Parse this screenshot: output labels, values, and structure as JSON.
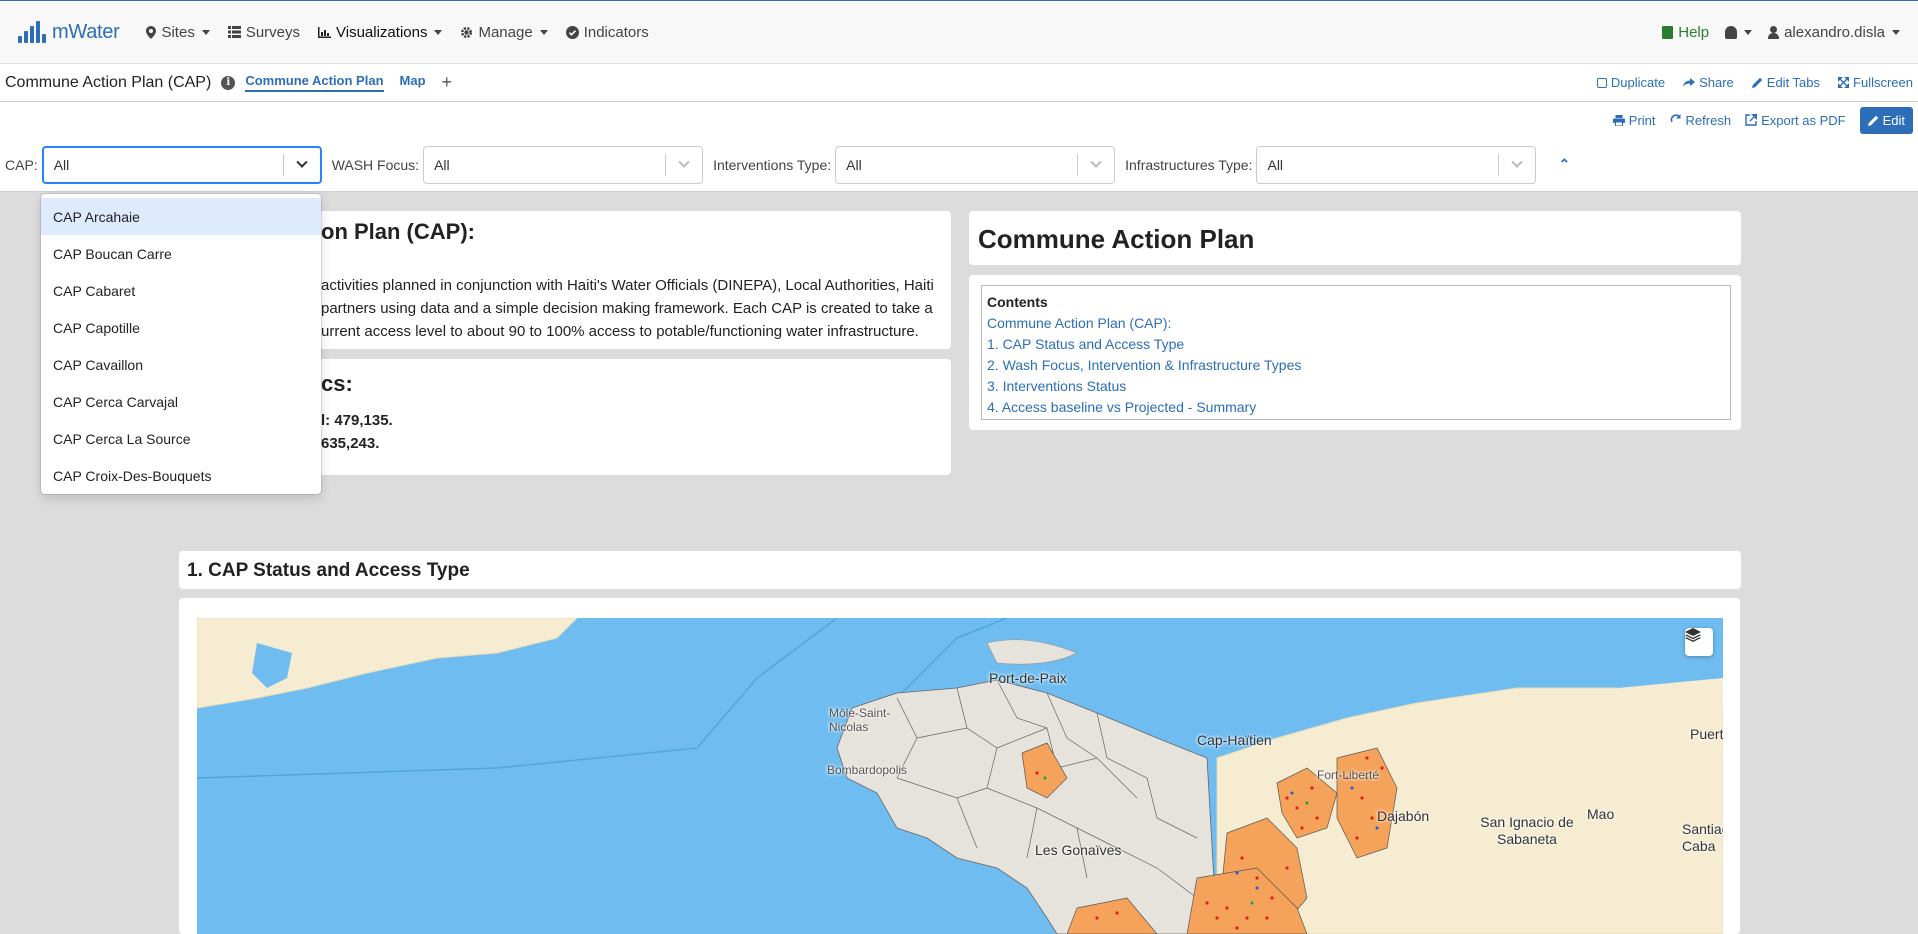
{
  "nav": {
    "brand": "mWater",
    "items": [
      "Sites",
      "Surveys",
      "Visualizations",
      "Manage",
      "Indicators"
    ],
    "help": "Help",
    "user": "alexandro.disla"
  },
  "titlebar": {
    "title": "Commune Action Plan (CAP)",
    "tabs": [
      "Commune Action Plan",
      "Map"
    ],
    "add": "+",
    "actions": [
      "Duplicate",
      "Share",
      "Edit Tabs",
      "Fullscreen"
    ]
  },
  "toolbar": {
    "print": "Print",
    "refresh": "Refresh",
    "export": "Export as PDF",
    "edit": "Edit"
  },
  "filters": [
    {
      "label": "CAP:",
      "value": "All"
    },
    {
      "label": "WASH Focus:",
      "value": "All"
    },
    {
      "label": "Interventions Type:",
      "value": "All"
    },
    {
      "label": "Infrastructures Type:",
      "value": "All"
    }
  ],
  "dropdown": {
    "options": [
      "CAP Arcahaie",
      "CAP Boucan Carre",
      "CAP Cabaret",
      "CAP Capotille",
      "CAP Cavaillon",
      "CAP Cerca Carvajal",
      "CAP Cerca La Source",
      "CAP Croix-Des-Bouquets"
    ]
  },
  "intro": {
    "heading": "on Plan (CAP):",
    "line1": "activities planned in conjunction with Haiti's Water Officials (DINEPA), Local Authorities, Haiti",
    "line2": "partners using data and a simple decision making framework. Each CAP is created to take a",
    "line3": "urrent access level to about 90 to 100% access to potable/functioning water infrastructure."
  },
  "stats": {
    "heading": "cs:",
    "line1": "l: 479,135.",
    "line2": "635,243."
  },
  "cap_panel": {
    "heading": "Commune Action Plan",
    "contents_title": "Contents",
    "links": [
      "Commune Action Plan (CAP):",
      "1. CAP Status and Access Type",
      "2. Wash Focus, Intervention & Infrastructure Types",
      "3. Interventions Status",
      "4. Access baseline vs Projected  - Summary"
    ]
  },
  "section1": {
    "heading": "1. CAP Status and Access Type"
  },
  "map": {
    "labels": [
      "Port-de-Paix",
      "Môle-Saint-Nicolas",
      "Bombardopolis",
      "Cap-Haïtien",
      "Fort-Liberté",
      "Dajabón",
      "San Ignacio de Sabaneta",
      "Mao",
      "Puert",
      "Santiag Caba",
      "Les Gonaïves"
    ]
  }
}
